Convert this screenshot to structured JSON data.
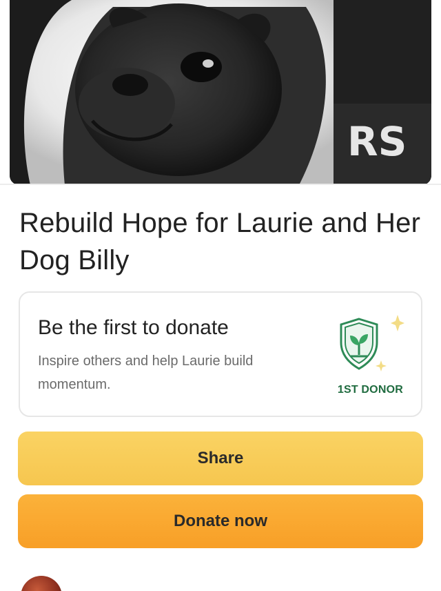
{
  "campaign": {
    "title": "Rebuild Hope for Laurie and Her Dog Billy"
  },
  "hero_image": {
    "description_icon": "dog-photo"
  },
  "first_donor_card": {
    "heading": "Be the first to donate",
    "subtext": "Inspire others and help Laurie build momentum.",
    "badge_label": "1ST DONOR",
    "badge_icon": "shield-sprout-icon",
    "sparkle_icon": "sparkle-icon"
  },
  "actions": {
    "share_label": "Share",
    "donate_label": "Donate now"
  },
  "organizer": {
    "avatar_icon": "organizer-avatar"
  },
  "colors": {
    "share_button": "#f6c64f",
    "donate_button": "#f89f27",
    "badge_green": "#1f6b3f"
  }
}
